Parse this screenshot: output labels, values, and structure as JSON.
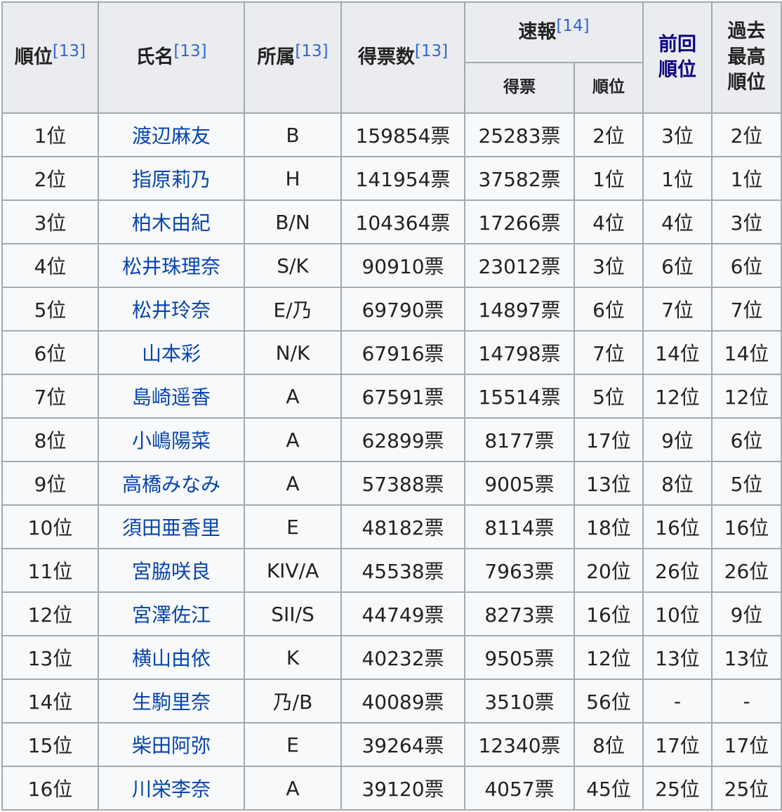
{
  "headers": {
    "rank": "順位",
    "name": "氏名",
    "team": "所属",
    "votes": "得票数",
    "prelim": "速報",
    "prelim_votes": "得票",
    "prelim_rank": "順位",
    "prev_rank_line1": "前回",
    "prev_rank_line2": "順位",
    "best_line1": "過去",
    "best_line2": "最高",
    "best_line3": "順位",
    "ref13": "[13]",
    "ref14": "[14]"
  },
  "rows": [
    {
      "rank": "1位",
      "name": "渡辺麻友",
      "team": "B",
      "votes": "159854票",
      "prelim_votes": "25283票",
      "prelim_rank": "2位",
      "prev": "3位",
      "best": "2位"
    },
    {
      "rank": "2位",
      "name": "指原莉乃",
      "team": "H",
      "votes": "141954票",
      "prelim_votes": "37582票",
      "prelim_rank": "1位",
      "prev": "1位",
      "best": "1位"
    },
    {
      "rank": "3位",
      "name": "柏木由紀",
      "team": "B/N",
      "votes": "104364票",
      "prelim_votes": "17266票",
      "prelim_rank": "4位",
      "prev": "4位",
      "best": "3位"
    },
    {
      "rank": "4位",
      "name": "松井珠理奈",
      "team": "S/K",
      "votes": "90910票",
      "prelim_votes": "23012票",
      "prelim_rank": "3位",
      "prev": "6位",
      "best": "6位"
    },
    {
      "rank": "5位",
      "name": "松井玲奈",
      "team": "E/乃",
      "votes": "69790票",
      "prelim_votes": "14897票",
      "prelim_rank": "6位",
      "prev": "7位",
      "best": "7位"
    },
    {
      "rank": "6位",
      "name": "山本彩",
      "team": "N/K",
      "votes": "67916票",
      "prelim_votes": "14798票",
      "prelim_rank": "7位",
      "prev": "14位",
      "best": "14位"
    },
    {
      "rank": "7位",
      "name": "島崎遥香",
      "team": "A",
      "votes": "67591票",
      "prelim_votes": "15514票",
      "prelim_rank": "5位",
      "prev": "12位",
      "best": "12位"
    },
    {
      "rank": "8位",
      "name": "小嶋陽菜",
      "team": "A",
      "votes": "62899票",
      "prelim_votes": "8177票",
      "prelim_rank": "17位",
      "prev": "9位",
      "best": "6位"
    },
    {
      "rank": "9位",
      "name": "高橋みなみ",
      "team": "A",
      "votes": "57388票",
      "prelim_votes": "9005票",
      "prelim_rank": "13位",
      "prev": "8位",
      "best": "5位"
    },
    {
      "rank": "10位",
      "name": "須田亜香里",
      "team": "E",
      "votes": "48182票",
      "prelim_votes": "8114票",
      "prelim_rank": "18位",
      "prev": "16位",
      "best": "16位"
    },
    {
      "rank": "11位",
      "name": "宮脇咲良",
      "team": "KIV/A",
      "votes": "45538票",
      "prelim_votes": "7963票",
      "prelim_rank": "20位",
      "prev": "26位",
      "best": "26位"
    },
    {
      "rank": "12位",
      "name": "宮澤佐江",
      "team": "SII/S",
      "votes": "44749票",
      "prelim_votes": "8273票",
      "prelim_rank": "16位",
      "prev": "10位",
      "best": "9位"
    },
    {
      "rank": "13位",
      "name": "横山由依",
      "team": "K",
      "votes": "40232票",
      "prelim_votes": "9505票",
      "prelim_rank": "12位",
      "prev": "13位",
      "best": "13位"
    },
    {
      "rank": "14位",
      "name": "生駒里奈",
      "team": "乃/B",
      "votes": "40089票",
      "prelim_votes": "3510票",
      "prelim_rank": "56位",
      "prev": "-",
      "best": "-"
    },
    {
      "rank": "15位",
      "name": "柴田阿弥",
      "team": "E",
      "votes": "39264票",
      "prelim_votes": "12340票",
      "prelim_rank": "8位",
      "prev": "17位",
      "best": "17位"
    },
    {
      "rank": "16位",
      "name": "川栄李奈",
      "team": "A",
      "votes": "39120票",
      "prelim_votes": "4057票",
      "prelim_rank": "45位",
      "prev": "25位",
      "best": "25位"
    }
  ]
}
